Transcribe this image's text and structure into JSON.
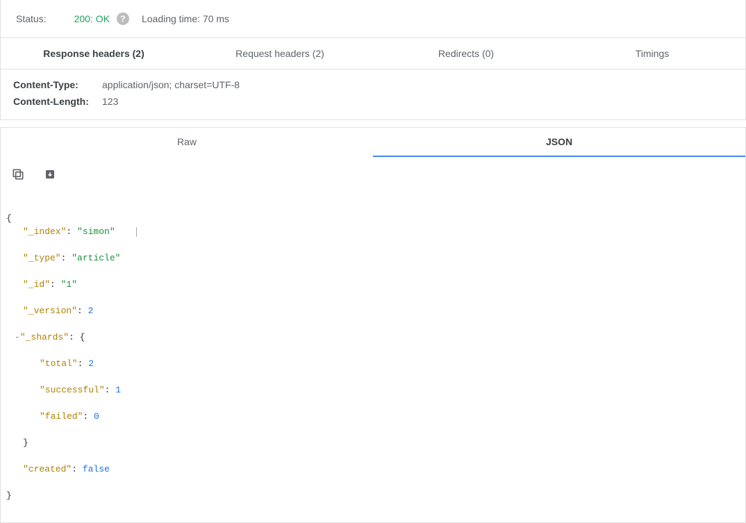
{
  "status": {
    "label": "Status:",
    "code_text": "200: OK",
    "help_glyph": "?",
    "loading_time_text": "Loading time: 70 ms"
  },
  "header_tabs": {
    "response": "Response headers (2)",
    "request": "Request headers (2)",
    "redirects": "Redirects (0)",
    "timings": "Timings"
  },
  "response_headers": {
    "content_type_key": "Content-Type:",
    "content_type_val": "application/json; charset=UTF-8",
    "content_length_key": "Content-Length:",
    "content_length_val": "123"
  },
  "body_tabs": {
    "raw": "Raw",
    "json": "JSON"
  },
  "json": {
    "open": "{",
    "l_index_k": "\"_index\"",
    "l_index_v": "\"simon\"",
    "l_type_k": "\"_type\"",
    "l_type_v": "\"article\"",
    "l_id_k": "\"_id\"",
    "l_id_v": "\"1\"",
    "l_version_k": "\"_version\"",
    "l_version_v": "2",
    "toggle": "-",
    "l_shards_k": "\"_shards\"",
    "l_total_k": "\"total\"",
    "l_total_v": "2",
    "l_succ_k": "\"successful\"",
    "l_succ_v": "1",
    "l_fail_k": "\"failed\"",
    "l_fail_v": "0",
    "l_created_k": "\"created\"",
    "l_created_v": "false",
    "colon": ": ",
    "brace_open": "{",
    "brace_close": "}",
    "close": "}"
  }
}
